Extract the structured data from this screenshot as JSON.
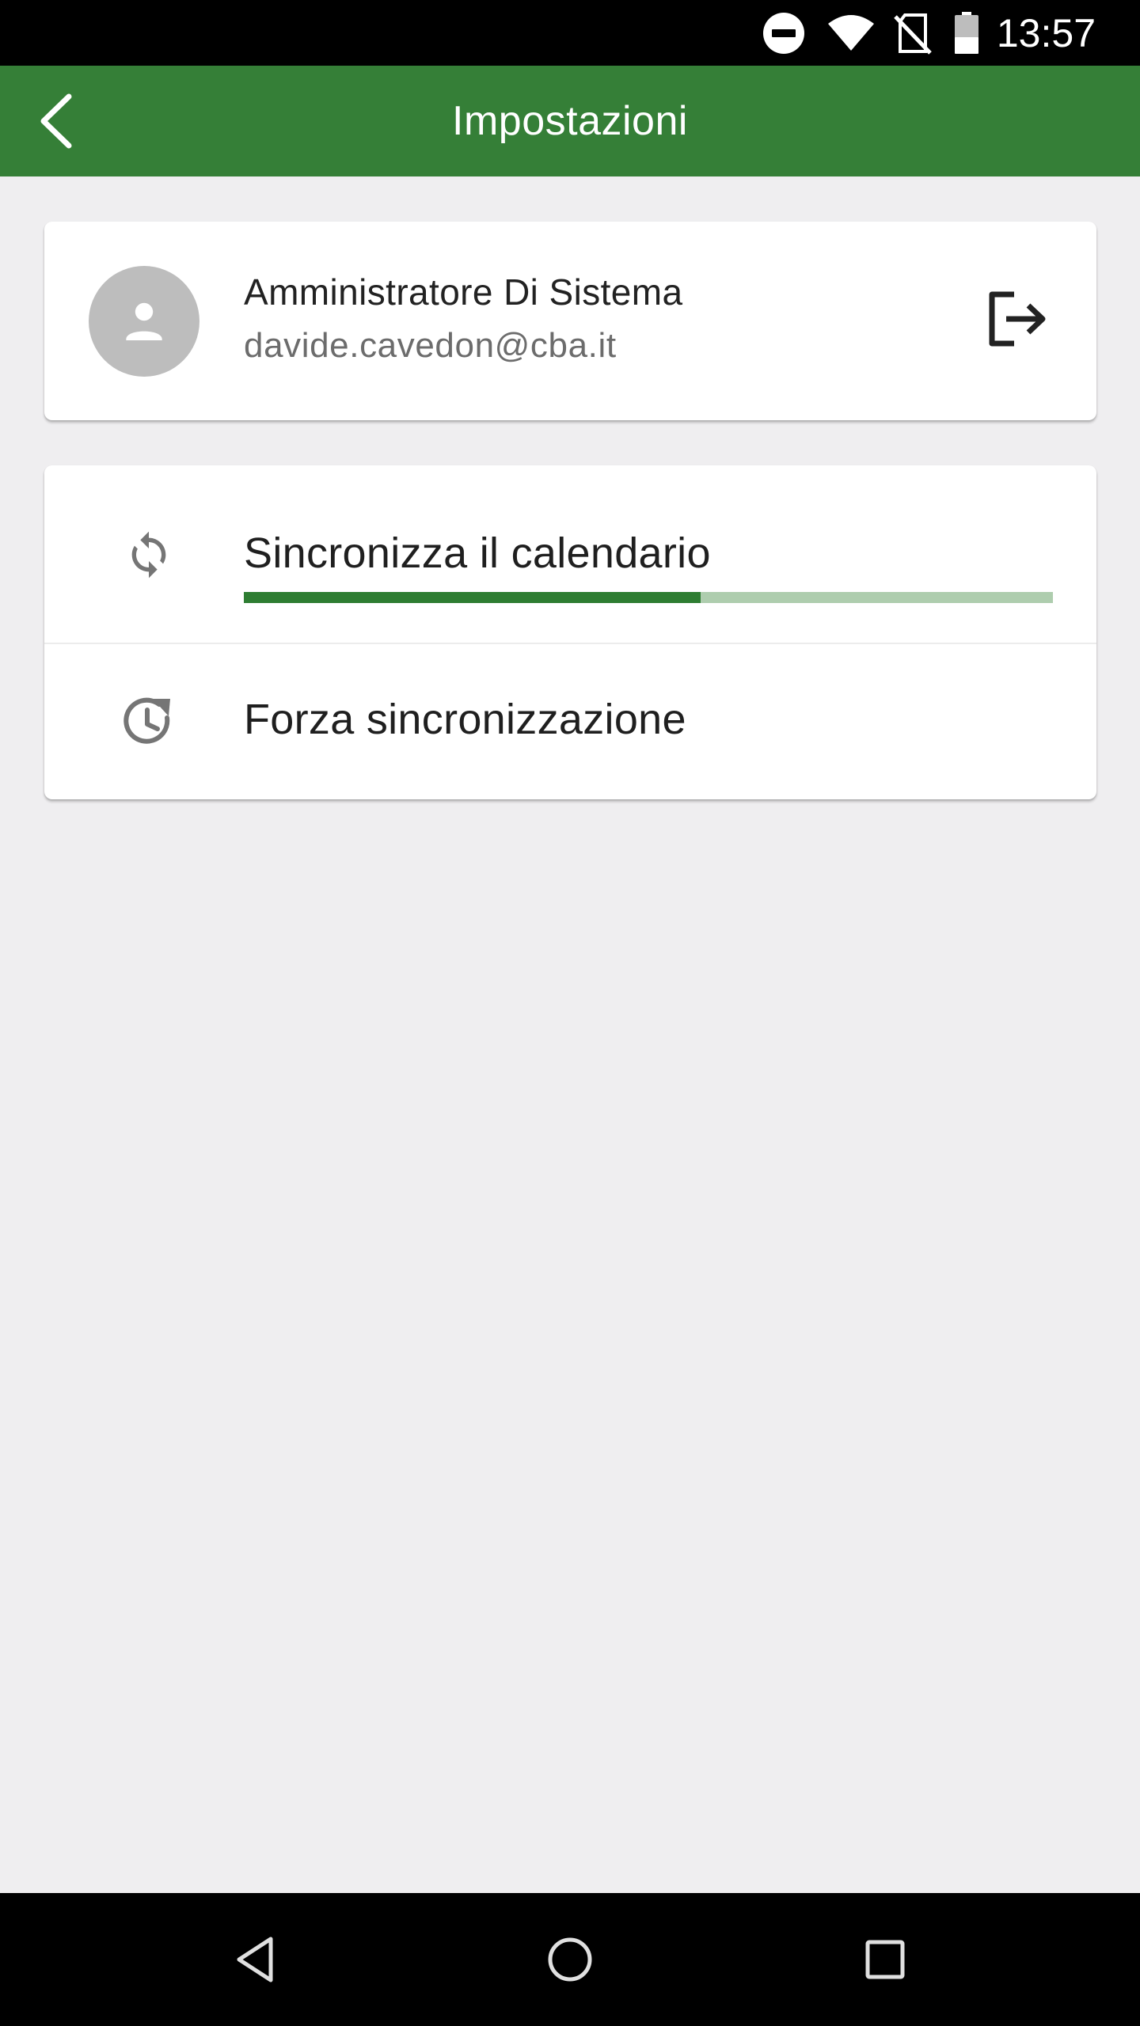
{
  "status_bar": {
    "time": "13:57",
    "icons": [
      "do-not-disturb-icon",
      "wifi-icon",
      "no-sim-icon",
      "battery-icon"
    ]
  },
  "app_bar": {
    "title": "Impostazioni",
    "back_icon": "chevron-left-icon",
    "background_color": "#357f37"
  },
  "profile": {
    "name": "Amministratore Di Sistema",
    "email": "davide.cavedon@cba.it",
    "avatar_icon": "person-icon",
    "logout_icon": "logout-icon"
  },
  "sync": {
    "items": [
      {
        "label": "Sincronizza il calendario",
        "icon": "sync-icon",
        "progress": 0.565
      },
      {
        "label": "Forza sincronizzazione",
        "icon": "history-refresh-icon"
      }
    ],
    "progress_color": "#2e7d32",
    "progress_track_color": "#aecdae"
  },
  "nav_bar": {
    "buttons": [
      "back-triangle-icon",
      "home-circle-icon",
      "recents-square-icon"
    ]
  }
}
